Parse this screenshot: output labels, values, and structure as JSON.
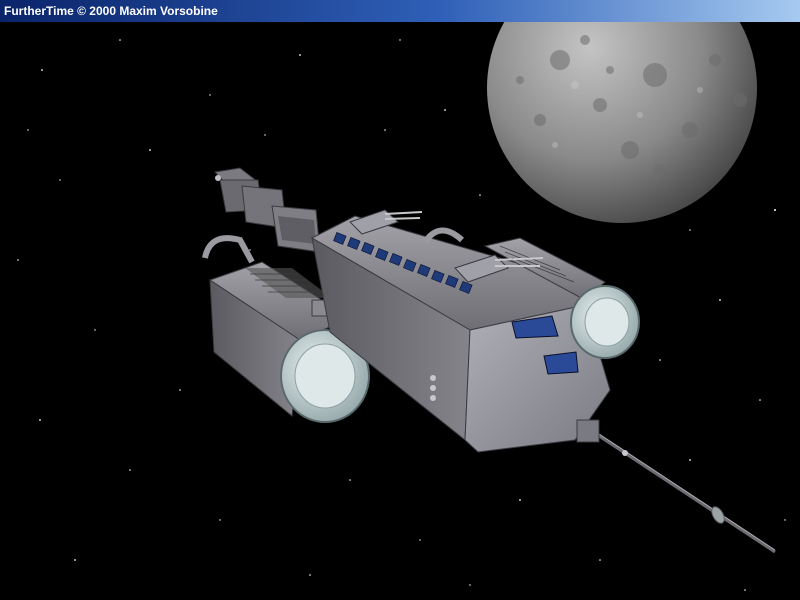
{
  "window": {
    "title": "FurtherTime © 2000 Maxim Vorsobine"
  },
  "scene": {
    "background_color": "#000000",
    "hull_color": "#8e8e94",
    "engine_color": "#b8c4c8",
    "window_color": "#1e3a78"
  }
}
